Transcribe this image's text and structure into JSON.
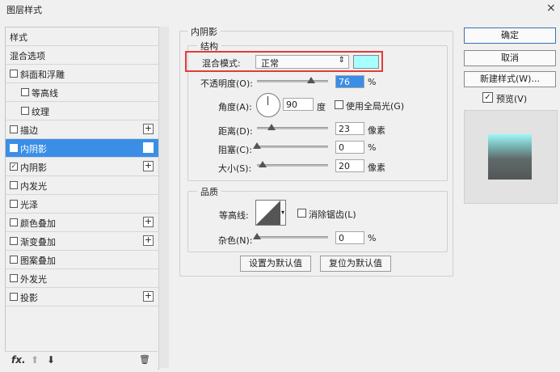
{
  "window": {
    "title": "图层样式",
    "close": "×"
  },
  "sidebar": {
    "items": [
      {
        "label": "样式"
      },
      {
        "label": "混合选项"
      },
      {
        "label": "斜面和浮雕",
        "checked": false
      },
      {
        "label": "等高线",
        "checked": false
      },
      {
        "label": "纹理",
        "checked": false
      },
      {
        "label": "描边",
        "checked": false
      },
      {
        "label": "内阴影",
        "checked": true
      },
      {
        "label": "内阴影",
        "checked": true
      },
      {
        "label": "内发光",
        "checked": false
      },
      {
        "label": "光泽",
        "checked": false
      },
      {
        "label": "颜色叠加",
        "checked": false
      },
      {
        "label": "渐变叠加",
        "checked": false
      },
      {
        "label": "图案叠加",
        "checked": false
      },
      {
        "label": "外发光",
        "checked": false
      },
      {
        "label": "投影",
        "checked": false
      }
    ],
    "check_mark": "✓",
    "plus": "+",
    "bottom_icons": {
      "fx": "fx.",
      "up": "⬆",
      "down": "⬇",
      "trash": "🗑"
    }
  },
  "panel": {
    "section_title": "内阴影",
    "structure": {
      "title": "结构",
      "blend_mode_label": "混合模式:",
      "blend_mode_value": "正常",
      "shadow_color": "#a8ffff",
      "opacity_label": "不透明度(O):",
      "opacity_value": "76",
      "opacity_unit": "%",
      "opacity_fraction": 0.76,
      "angle_label": "角度(A):",
      "angle_value": "90",
      "angle_unit": "度",
      "global_light_label": "使用全局光(G)",
      "global_light_checked": false,
      "distance_label": "距离(D):",
      "distance_value": "23",
      "distance_unit": "像素",
      "distance_fraction": 0.2,
      "choke_label": "阻塞(C):",
      "choke_value": "0",
      "choke_unit": "%",
      "choke_fraction": 0.0,
      "size_label": "大小(S):",
      "size_value": "20",
      "size_unit": "像素",
      "size_fraction": 0.08
    },
    "quality": {
      "title": "品质",
      "contour_label": "等高线:",
      "anti_alias_label": "消除锯齿(L)",
      "anti_alias_checked": false,
      "noise_label": "杂色(N):",
      "noise_value": "0",
      "noise_unit": "%",
      "noise_fraction": 0.0
    },
    "buttons": {
      "set_default": "设置为默认值",
      "reset_default": "复位为默认值"
    }
  },
  "right": {
    "ok": "确定",
    "cancel": "取消",
    "new_style": "新建样式(W)...",
    "preview_label": "预览(V)",
    "preview_checked": true
  },
  "colors": {
    "selection": "#3a8ee6",
    "highlight_border": "#e23b3b"
  }
}
